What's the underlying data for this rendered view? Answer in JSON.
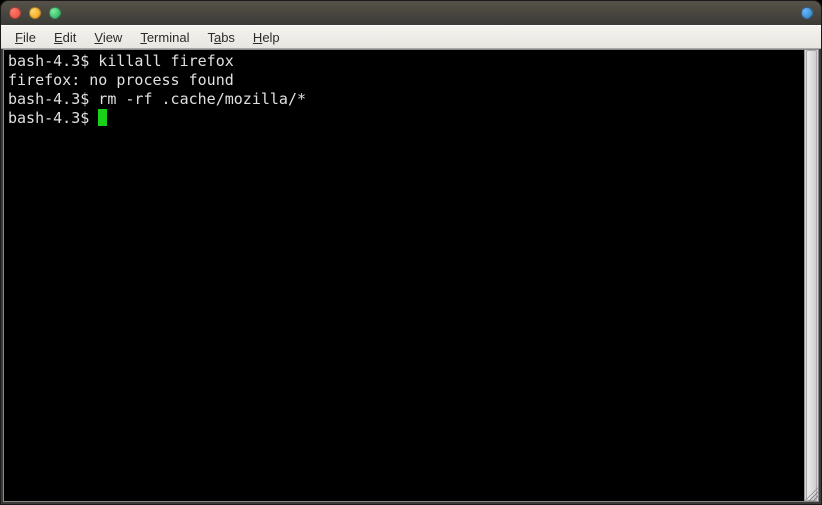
{
  "menubar": {
    "items": [
      {
        "label": "File",
        "mnemonic": "F"
      },
      {
        "label": "Edit",
        "mnemonic": "E"
      },
      {
        "label": "View",
        "mnemonic": "V"
      },
      {
        "label": "Terminal",
        "mnemonic": "T"
      },
      {
        "label": "Tabs",
        "mnemonic": "a"
      },
      {
        "label": "Help",
        "mnemonic": "H"
      }
    ]
  },
  "terminal": {
    "prompt": "bash-4.3$",
    "lines": [
      {
        "prompt": "bash-4.3$ ",
        "text": "killall firefox"
      },
      {
        "prompt": "",
        "text": "firefox: no process found"
      },
      {
        "prompt": "bash-4.3$ ",
        "text": "rm -rf .cache/mozilla/*"
      },
      {
        "prompt": "bash-4.3$ ",
        "text": "",
        "cursor": true
      }
    ]
  },
  "colors": {
    "terminal_bg": "#000000",
    "terminal_fg": "#e0e0e0",
    "cursor": "#18d118",
    "titlebar": "#3c3b37"
  }
}
